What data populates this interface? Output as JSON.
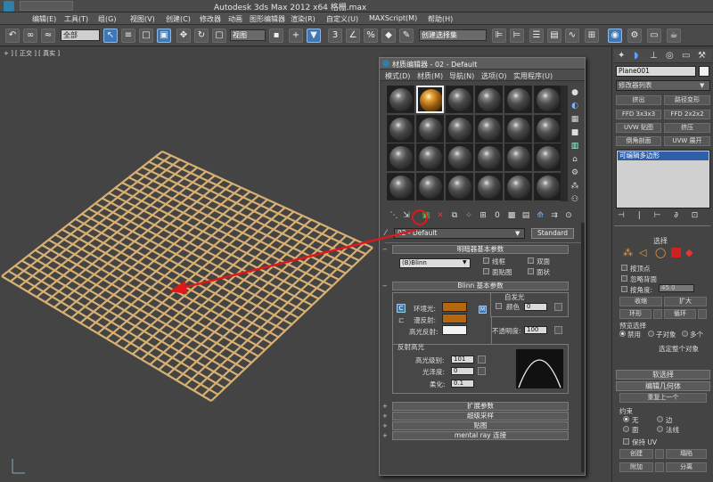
{
  "window_title": "Autodesk 3ds Max  2012 x64   格栅.max",
  "menu": [
    "编辑(E)",
    "工具(T)",
    "组(G)",
    "视图(V)",
    "创建(C)",
    "修改器",
    "动画",
    "图形编辑器",
    "渲染(R)",
    "自定义(U)",
    "MAXScript(M)",
    "帮助(H)"
  ],
  "toolbar": {
    "selection_filter": "全部",
    "coord_system": "视图",
    "named_selection": "创建选择集"
  },
  "viewport": {
    "label": "+ ] [ 正交 ] [ 真实 ]"
  },
  "material_editor": {
    "title": "材质编辑器 - 02 - Default",
    "menu": [
      "模式(D)",
      "材质(M)",
      "导航(N)",
      "选项(O)",
      "实用程序(U)"
    ],
    "material_name": "02 - Default",
    "material_type": "Standard",
    "rollouts": {
      "shader_basic": "明暗器基本参数",
      "shader_type": "(B)Blinn",
      "wire": "线框",
      "two_sided": "双面",
      "face_map": "面贴图",
      "faceted": "面状",
      "blinn_basic": "Blinn 基本参数",
      "self_illum": "自发光",
      "color": "颜色",
      "color_value": "0",
      "ambient": "环境光:",
      "diffuse": "漫反射:",
      "specular": "高光反射:",
      "opacity": "不透明度:",
      "opacity_value": "100",
      "specular_highlights": "反射高光",
      "spec_level": "高光级别:",
      "spec_level_value": "101",
      "glossiness": "光泽度:",
      "glossiness_value": "0",
      "soften": "柔化:",
      "soften_value": "0.1",
      "extended": "扩展参数",
      "supersampling": "超级采样",
      "maps": "贴图",
      "mental_ray": "mental ray 连接"
    },
    "swatch_colors": {
      "ambient": "#b5670e",
      "diffuse": "#b5670e",
      "specular": "#f2f2f2"
    },
    "letter_c": "C",
    "letter_m": "M"
  },
  "command_panel": {
    "object_name": "Plane001",
    "modifier_list": "修改器列表",
    "buttons": [
      "挤出",
      "路径变形",
      "FFD 3x3x3",
      "FFD 2x2x2",
      "UVW 贴图",
      "挤压",
      "倒角剖面",
      "UVW 展开"
    ],
    "stack_item": "可编辑多边形",
    "selection_title": "选择",
    "by_vertex": "按顶点",
    "ignore_backfacing": "忽略背面",
    "by_angle": "按角度:",
    "angle_value": "45.0",
    "shrink": "收缩",
    "grow": "扩大",
    "ring": "环形",
    "loop": "循环",
    "preview_selection": "预览选择",
    "disabled": "禁用",
    "sub_object": "子对象",
    "multi": "多个",
    "select_whole": "选定整个对象",
    "soft_selection": "软选择",
    "edit_geometry": "编辑几何体",
    "repeat_last": "重复上一个",
    "constraints": "约束",
    "none": "无",
    "edge": "边",
    "face": "面",
    "normal": "法线",
    "preserve_uv": "保持 UV",
    "create": "创建",
    "collapse": "塌陷",
    "attach": "附加",
    "detach": "分离"
  },
  "colors": {
    "grid": "#d8b072",
    "arrow": "#e0181c",
    "accent": "#3d78b8"
  }
}
